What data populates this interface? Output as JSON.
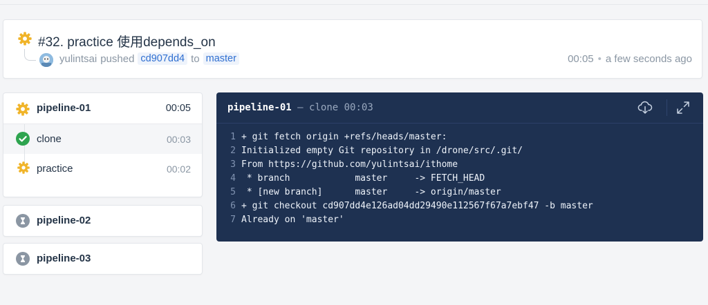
{
  "build": {
    "title": "#32. practice 使用depends_on",
    "author": "yulintsai",
    "action": "pushed",
    "commit": "cd907dd4",
    "to_word": "to",
    "branch": "master",
    "duration": "00:05",
    "relative_time": "a few seconds ago"
  },
  "pipelines": [
    {
      "name": "pipeline-01",
      "time": "00:05",
      "status": "running",
      "steps": [
        {
          "name": "clone",
          "time": "00:03",
          "status": "success"
        },
        {
          "name": "practice",
          "time": "00:02",
          "status": "running"
        }
      ]
    },
    {
      "name": "pipeline-02",
      "status": "pending"
    },
    {
      "name": "pipeline-03",
      "status": "pending"
    }
  ],
  "terminal": {
    "pipeline": "pipeline-01",
    "separator": "—",
    "step": "clone",
    "time": "00:03",
    "download_icon": "cloud-download-icon",
    "fullscreen_icon": "expand-icon",
    "lines": [
      {
        "n": "1",
        "text": "+ git fetch origin +refs/heads/master:"
      },
      {
        "n": "2",
        "text": "Initialized empty Git repository in /drone/src/.git/"
      },
      {
        "n": "3",
        "text": "From https://github.com/yulintsai/ithome"
      },
      {
        "n": "4",
        "text": " * branch            master     -> FETCH_HEAD"
      },
      {
        "n": "5",
        "text": " * [new branch]      master     -> origin/master"
      },
      {
        "n": "6",
        "text": "+ git checkout cd907dd4e126ad04dd29490e112567f67a7ebf47 -b master"
      },
      {
        "n": "7",
        "text": "Already on 'master'"
      }
    ]
  },
  "colors": {
    "running": "#f0b429",
    "success": "#2ea44f",
    "pending": "#8b96a3",
    "terminal_bg": "#1e3151"
  }
}
